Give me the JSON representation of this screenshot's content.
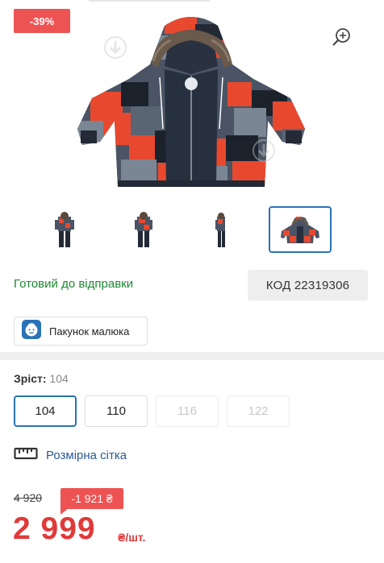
{
  "discount_badge": "-39%",
  "icons": {
    "zoom": "zoom-in-icon",
    "bundle": "baby-face-icon",
    "size_chart": "ruler-icon",
    "watermark": "download-arrow-icon"
  },
  "gallery": {
    "thumbnails": [
      {
        "name": "thumb-overall-front",
        "active": false
      },
      {
        "name": "thumb-overall-side",
        "active": false
      },
      {
        "name": "thumb-overall-back",
        "active": false
      },
      {
        "name": "thumb-jacket",
        "active": true
      }
    ]
  },
  "availability": "Готовий до відправки",
  "product_code": "КОД 22319306",
  "bundle": {
    "label": "Пакунок малюка"
  },
  "height": {
    "label": "Зріст:",
    "value": "104"
  },
  "sizes": [
    {
      "label": "104",
      "state": "selected"
    },
    {
      "label": "110",
      "state": "available"
    },
    {
      "label": "116",
      "state": "disabled"
    },
    {
      "label": "122",
      "state": "disabled"
    }
  ],
  "size_chart": {
    "label": "Розмірна сітка"
  },
  "price": {
    "old": "4 920",
    "diff": "-1 921 ₴",
    "current": "2 999",
    "unit": "₴/шт."
  },
  "colors": {
    "badge_red": "#ee5353",
    "price_red": "#e03a3a",
    "ready_green": "#1c8a32",
    "link_blue": "#2a5a94",
    "selected_blue": "#2a72b5"
  }
}
